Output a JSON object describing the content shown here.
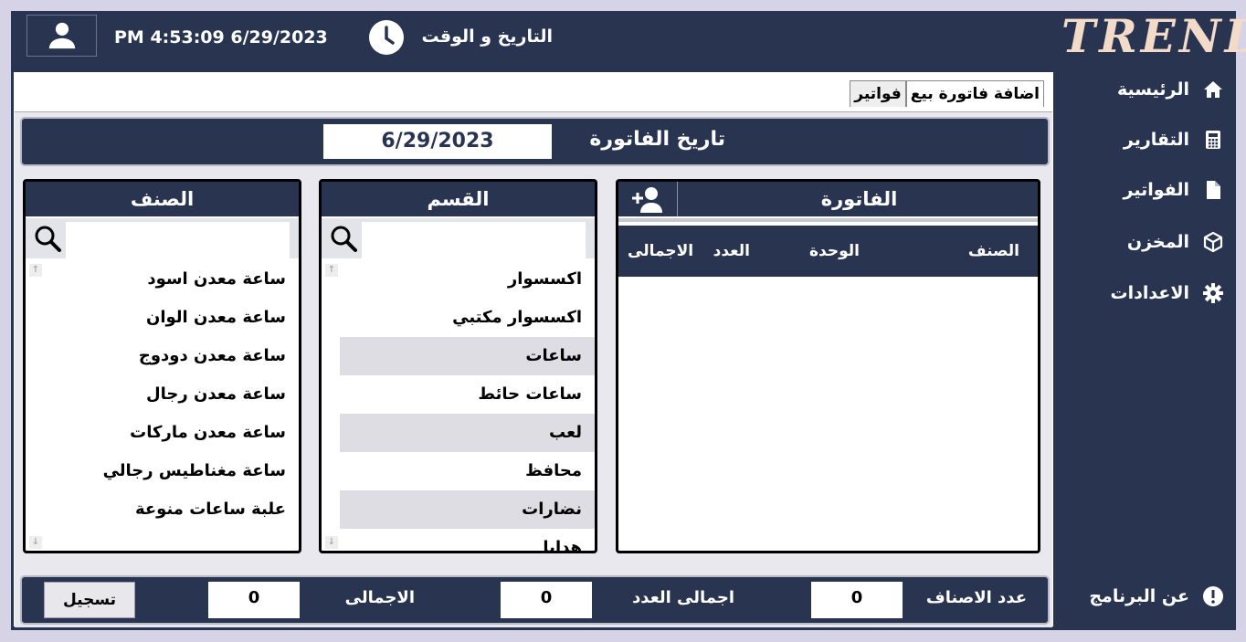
{
  "header": {
    "datetime_value": "PM 4:53:09 6/29/2023",
    "datetime_label": "التاريخ و الوقت",
    "logo_text": "TREND"
  },
  "sidebar": {
    "items": [
      {
        "label": "الرئيسية",
        "icon": "home-icon"
      },
      {
        "label": "التقارير",
        "icon": "calculator-icon"
      },
      {
        "label": "الفواتير",
        "icon": "file-icon"
      },
      {
        "label": "المخزن",
        "icon": "box-icon"
      },
      {
        "label": "الاعدادات",
        "icon": "gear-icon"
      }
    ],
    "about": {
      "label": "عن البرنامج",
      "icon": "info-icon"
    }
  },
  "tabs": [
    {
      "label": "اضافة فاتورة بيع",
      "active": true
    },
    {
      "label": "فواتير",
      "active": false
    }
  ],
  "invoice_date": {
    "label": "تاريخ الفاتورة",
    "value": "6/29/2023"
  },
  "item_panel": {
    "title": "الصنف",
    "items": [
      "ساعة معدن اسود",
      "ساعة معدن الوان",
      "ساعة معدن دودوج",
      "ساعة معدن رجال",
      "ساعة معدن ماركات",
      "ساعة مغناطيس رجالي",
      "علبة ساعات منوعة"
    ]
  },
  "category_panel": {
    "title": "القسم",
    "items": [
      "اكسسوار",
      "اكسسوار مكتبي",
      "ساعات",
      "ساعات حائط",
      "لعب",
      "محافظ",
      "نضارات",
      "هدايا"
    ]
  },
  "invoice_panel": {
    "title": "الفاتورة",
    "columns": [
      "الصنف",
      "الوحدة",
      "العدد",
      "الاجمالى"
    ]
  },
  "totals": {
    "items_count_label": "عدد الاصناف",
    "items_count_value": "0",
    "total_qty_label": "اجمالى العدد",
    "total_qty_value": "0",
    "total_label": "الاجمالى",
    "total_value": "0",
    "save_label": "تسجيل"
  },
  "colors": {
    "primary": "#293550",
    "page_bg": "#d6d3e6",
    "logo": "#f2dbc8"
  }
}
